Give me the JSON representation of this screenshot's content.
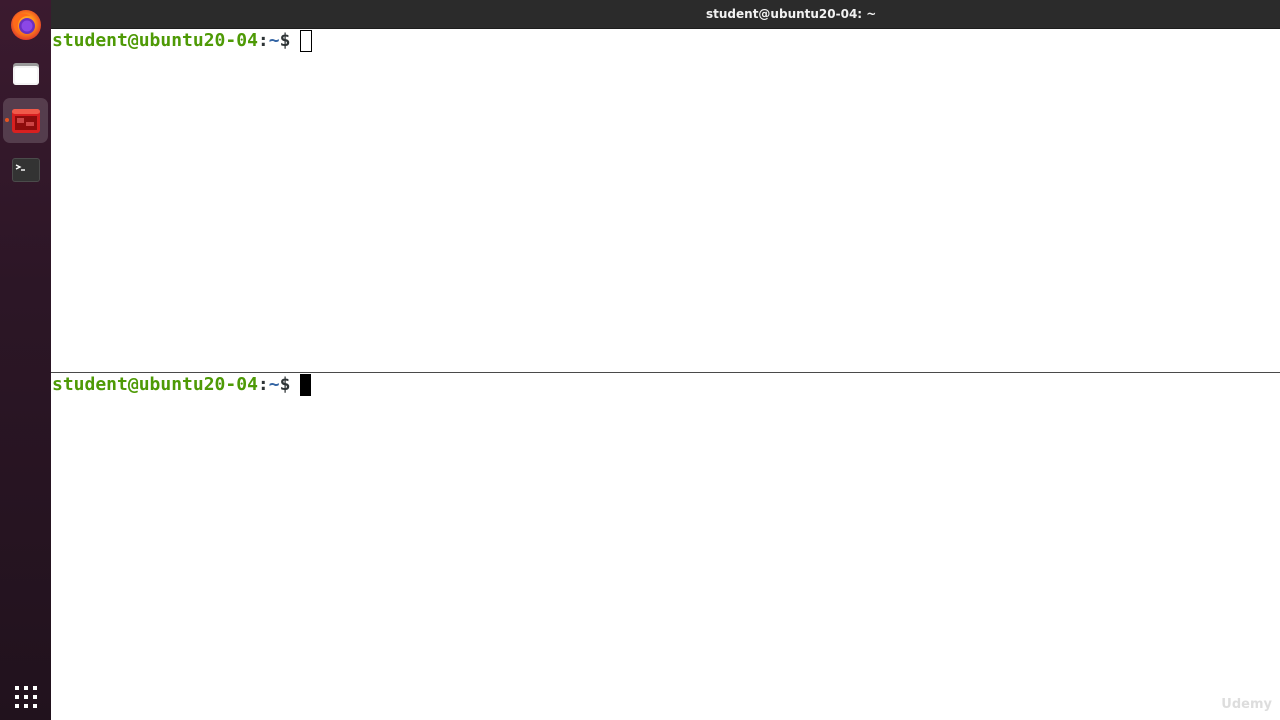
{
  "window": {
    "title": "student@ubuntu20-04: ~"
  },
  "dock": {
    "items": [
      {
        "name": "firefox",
        "icon": "firefox-icon",
        "running": false
      },
      {
        "name": "files",
        "icon": "files-icon",
        "running": false
      },
      {
        "name": "terminal-running",
        "icon": "terminal-red-icon",
        "running": true,
        "active": true
      },
      {
        "name": "terminal",
        "icon": "terminal-icon",
        "running": false
      }
    ],
    "apps_icon": "apps-grid-icon"
  },
  "panes": {
    "top": {
      "user_host": "student@ubuntu20-04",
      "separator": ":",
      "path": "~",
      "dollar": "$",
      "cursor": "outline"
    },
    "bottom": {
      "user_host": "student@ubuntu20-04",
      "separator": ":",
      "path": "~",
      "dollar": "$",
      "cursor": "block"
    }
  },
  "watermark": "Udemy",
  "colors": {
    "prompt_user": "#4e9a06",
    "prompt_path": "#3465a4",
    "text": "#2e3436",
    "titlebar": "#2b2b2b",
    "accent": "#e95420"
  }
}
